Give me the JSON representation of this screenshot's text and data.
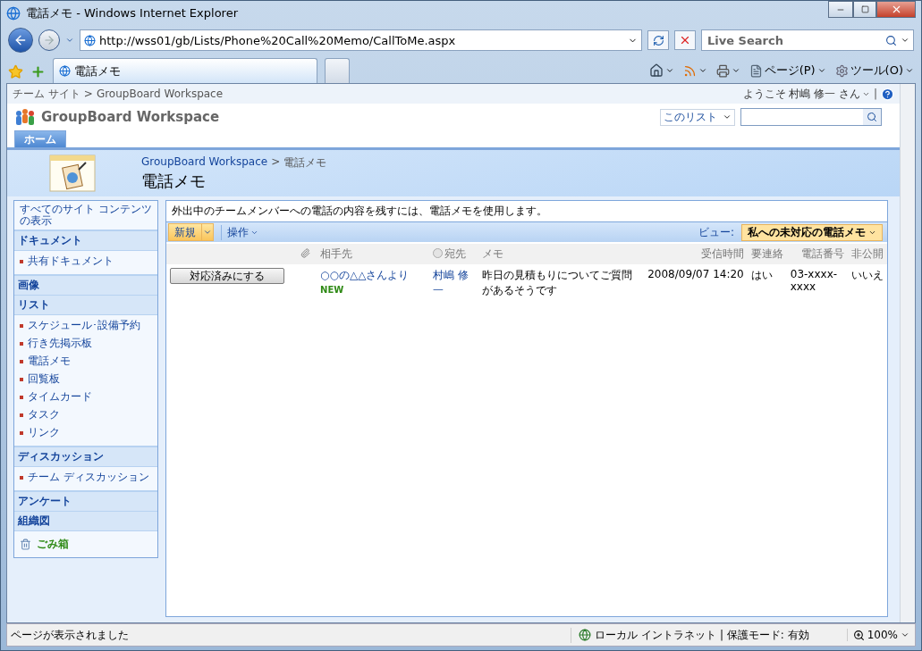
{
  "window": {
    "title": "電話メモ - Windows Internet Explorer"
  },
  "browser": {
    "address": "http://wss01/gb/Lists/Phone%20Call%20Memo/CallToMe.aspx",
    "search_placeholder": "Live Search",
    "tabs": [
      {
        "label": "電話メモ",
        "selected": true
      }
    ],
    "commands": [
      "ページ(P)",
      "ツール(O)"
    ]
  },
  "site": {
    "breadcrumb": [
      "チーム サイト",
      "GroupBoard Workspace"
    ],
    "breadcrumb_separator": ">",
    "welcome": "ようこそ 村嶋 修一 さん",
    "welcome_divider": "|",
    "title": "GroupBoard Workspace",
    "search_scope": "このリスト",
    "top_tabs": [
      {
        "label": "ホーム",
        "selected": true
      }
    ]
  },
  "page": {
    "breadcrumb": [
      "GroupBoard Workspace",
      "電話メモ"
    ],
    "breadcrumb_separator": ">",
    "title": "電話メモ"
  },
  "nav": {
    "view_all": "すべてのサイト コンテンツの表示",
    "sections": [
      {
        "heading": "ドキュメント",
        "items": [
          "共有ドキュメント"
        ]
      },
      {
        "heading": "画像"
      },
      {
        "heading": "リスト",
        "items": [
          "スケジュール･設備予約",
          "行き先掲示板",
          "電話メモ",
          "回覧板",
          "タイムカード",
          "タスク",
          "リンク"
        ]
      },
      {
        "heading": "ディスカッション",
        "items": [
          "チーム ディスカッション"
        ]
      },
      {
        "heading": "アンケート"
      },
      {
        "heading": "組織図"
      }
    ],
    "recycle_bin": "ごみ箱"
  },
  "list": {
    "description": "外出中のチームメンバーへの電話の内容を残すには、電話メモを使用します。",
    "new_button": "新規",
    "actions_menu": "操作",
    "view_label": "ビュー:",
    "view": "私への未対応の電話メモ",
    "columns": [
      "相手先",
      "宛先",
      "メモ",
      "受信時間",
      "要連絡",
      "電話番号",
      "非公開"
    ],
    "rows": [
      {
        "action": "対応済みにする",
        "caller": "○○の△△さんより",
        "is_new": true,
        "new_label": "NEW",
        "to": "村嶋 修一",
        "memo": "昨日の見積もりについてご質問があるそうです",
        "received": "2008/09/07 14:20",
        "callback": "はい",
        "phone": "03-xxxx-xxxx",
        "private": "いいえ"
      }
    ]
  },
  "status_bar": {
    "text": "ページが表示されました",
    "zone": "ローカル イントラネット | 保護モード: 有効",
    "zoom": "100%"
  }
}
